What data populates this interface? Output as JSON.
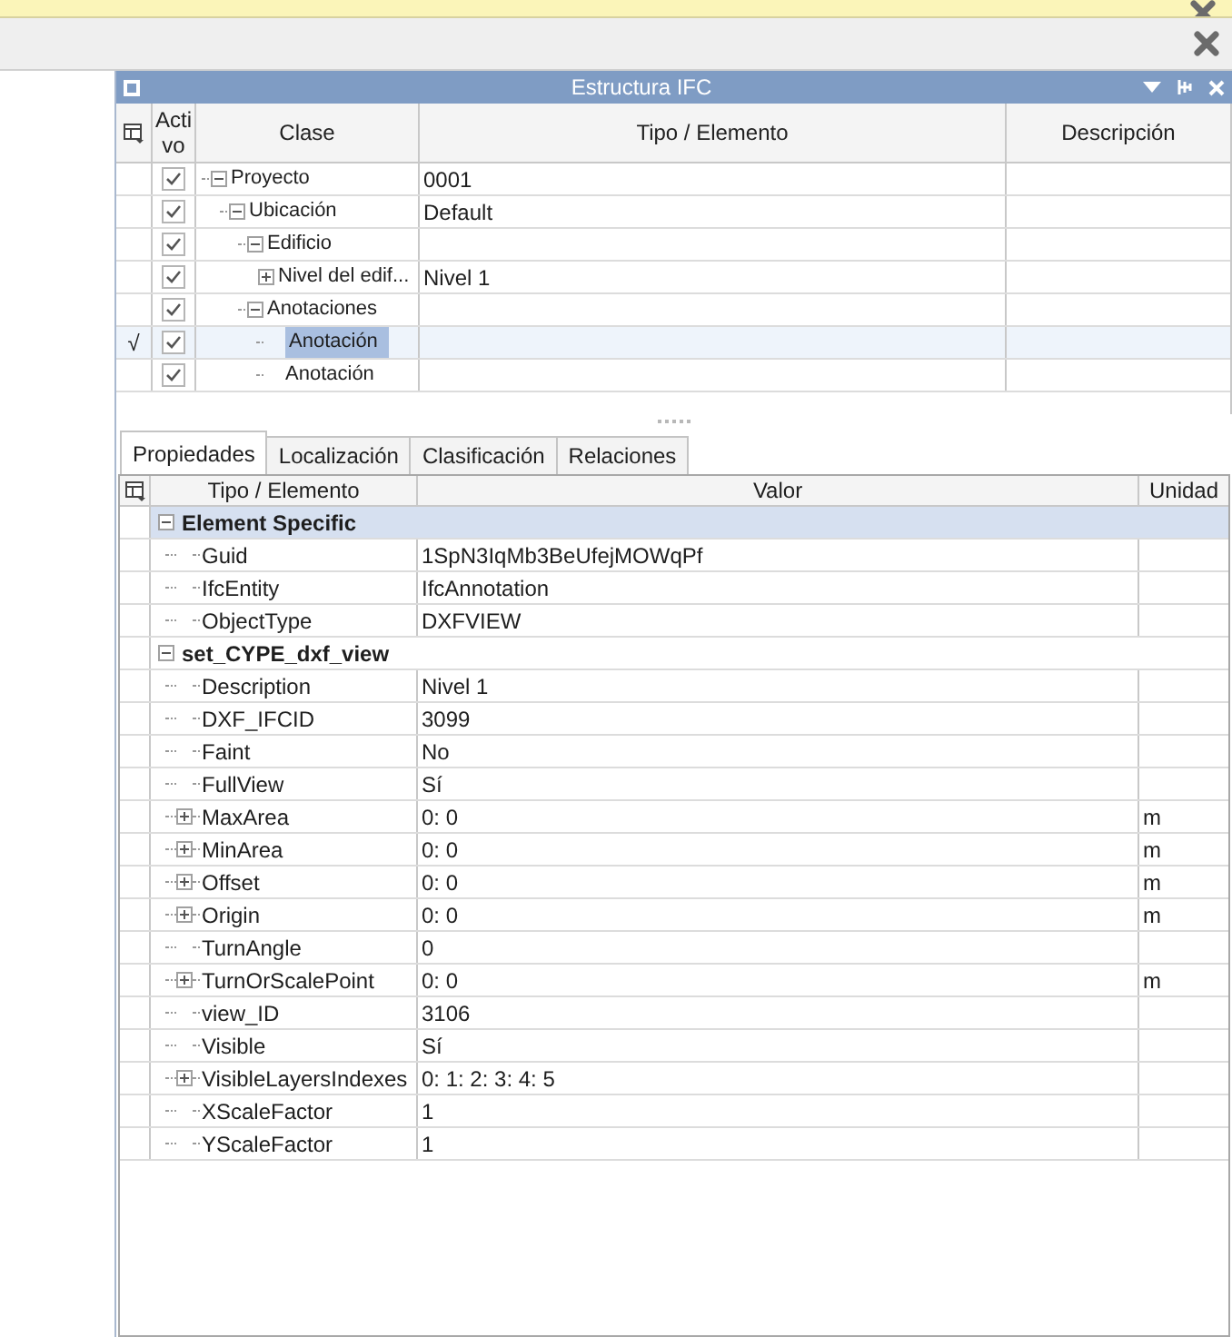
{
  "panel": {
    "title": "Estructura IFC"
  },
  "tree": {
    "columns": [
      "Acti\nvo",
      "Clase",
      "Tipo / Elemento",
      "Descripción"
    ],
    "rows": [
      {
        "label": "Proyecto",
        "value": "0001",
        "checked": true,
        "selected": false,
        "expanded": true,
        "children": [
          {
            "label": "Ubicación",
            "value": "Default",
            "checked": true,
            "selected": false,
            "expanded": true,
            "children": [
              {
                "label": "Edificio",
                "checked": true,
                "selected": false,
                "expanded": true,
                "children": [
                  {
                    "label": "Nivel del edif...",
                    "value": "Nivel 1",
                    "checked": true,
                    "selected": false,
                    "expanded": false
                  }
                ]
              },
              {
                "label": "Anotaciones",
                "checked": true,
                "selected": false,
                "expanded": true,
                "children": [
                  {
                    "label": "Anotación",
                    "checked": true,
                    "selected": true,
                    "current_mark": "√"
                  },
                  {
                    "label": "Anotación",
                    "checked": true,
                    "selected": false
                  }
                ]
              }
            ]
          }
        ]
      }
    ]
  },
  "tabs": [
    {
      "label": "Propiedades",
      "selected": true
    },
    {
      "label": "Localización",
      "selected": false
    },
    {
      "label": "Clasificación",
      "selected": false
    },
    {
      "label": "Relaciones",
      "selected": false
    }
  ],
  "properties": {
    "columns": [
      "Tipo / Elemento",
      "Valor",
      "Unidad"
    ],
    "groups": [
      {
        "name": "Element Specific",
        "expanded": true,
        "items": [
          {
            "name": "Guid",
            "value": "1SpN3IqMb3BeUfejMOWqPf"
          },
          {
            "name": "IfcEntity",
            "value": "IfcAnnotation"
          },
          {
            "name": "ObjectType",
            "value": "DXFVIEW"
          }
        ]
      },
      {
        "name": "set_CYPE_dxf_view",
        "expanded": true,
        "items": [
          {
            "name": "Description",
            "value": "Nivel 1"
          },
          {
            "name": "DXF_IFCID",
            "value": "3099"
          },
          {
            "name": "Faint",
            "value": "No"
          },
          {
            "name": "FullView",
            "value": "Sí"
          },
          {
            "name": "MaxArea",
            "value": "0: 0",
            "unit": "m",
            "expanded": false
          },
          {
            "name": "MinArea",
            "value": "0: 0",
            "unit": "m",
            "expanded": false
          },
          {
            "name": "Offset",
            "value": "0: 0",
            "unit": "m",
            "expanded": false
          },
          {
            "name": "Origin",
            "value": "0: 0",
            "unit": "m",
            "expanded": false
          },
          {
            "name": "TurnAngle",
            "value": "0"
          },
          {
            "name": "TurnOrScalePoint",
            "value": "0: 0",
            "unit": "m",
            "expanded": false
          },
          {
            "name": "view_ID",
            "value": "3106"
          },
          {
            "name": "Visible",
            "value": "Sí"
          },
          {
            "name": "VisibleLayersIndexes",
            "value": "0: 1: 2: 3: 4: 5",
            "expanded": false
          },
          {
            "name": "XScaleFactor",
            "value": "1"
          },
          {
            "name": "YScaleFactor",
            "value": "1"
          }
        ]
      }
    ]
  }
}
